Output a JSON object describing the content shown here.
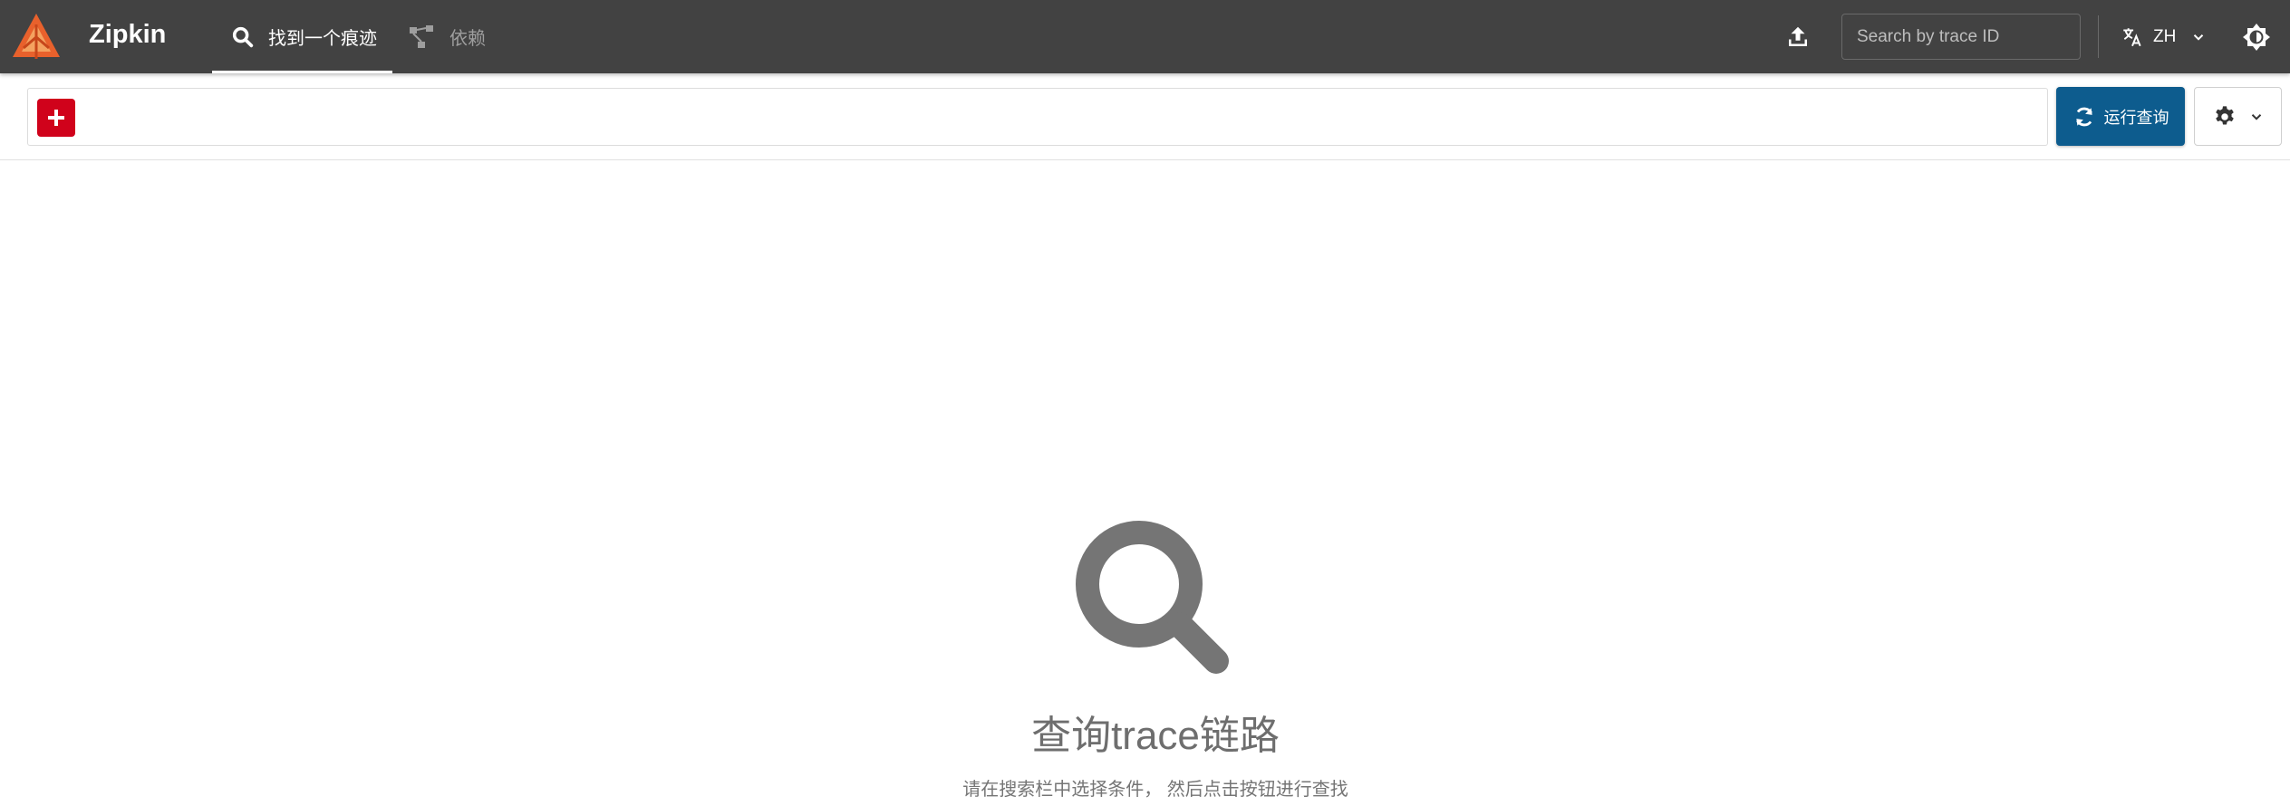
{
  "app": {
    "brand": "Zipkin"
  },
  "nav": {
    "tabs": [
      {
        "label": "找到一个痕迹",
        "icon": "search-icon",
        "active": true
      },
      {
        "label": "依赖",
        "icon": "dependency-graph-icon",
        "active": false
      }
    ]
  },
  "header": {
    "upload_icon": "upload-icon",
    "trace_search": {
      "placeholder": "Search by trace ID",
      "value": ""
    },
    "language": {
      "label": "ZH",
      "icon": "translate-icon"
    },
    "theme_icon": "theme-toggle-icon"
  },
  "query": {
    "add_icon": "plus-icon",
    "run_button_label": "运行查询",
    "run_icon": "refresh-icon",
    "settings_icon": "gear-icon"
  },
  "empty_state": {
    "icon": "search-icon",
    "title": "查询trace链路",
    "subtitle": "请在搜索栏中选择条件， 然后点击按钮进行查找"
  },
  "colors": {
    "header_bg": "#424242",
    "logo_orange": "#e8612c",
    "add_button": "#d0021b",
    "run_button": "#0d5c8e",
    "empty_icon": "#757575"
  }
}
